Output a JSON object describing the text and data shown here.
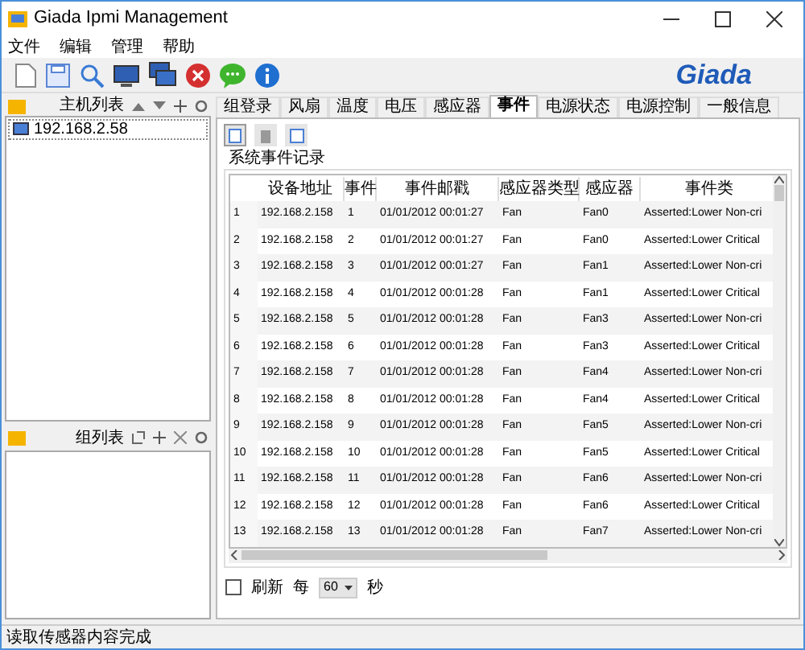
{
  "window": {
    "title": "Giada Ipmi Management"
  },
  "menu": [
    "文件",
    "编辑",
    "管理",
    "帮助"
  ],
  "logo": "Giada",
  "host_panel": {
    "title": "主机列表",
    "items": [
      {
        "label": "192.168.2.58",
        "selected": true
      }
    ]
  },
  "group_panel": {
    "title": "组列表"
  },
  "tabs": [
    {
      "label": "组登录",
      "selected": false
    },
    {
      "label": "风扇",
      "selected": false
    },
    {
      "label": "温度",
      "selected": false
    },
    {
      "label": "电压",
      "selected": false
    },
    {
      "label": "感应器",
      "selected": false
    },
    {
      "label": "事件",
      "selected": true
    },
    {
      "label": "电源状态",
      "selected": false
    },
    {
      "label": "电源控制",
      "selected": false
    },
    {
      "label": "一般信息",
      "selected": false
    }
  ],
  "group_box": {
    "title": "系统事件记录"
  },
  "table": {
    "columns": [
      "",
      "设备地址",
      "事件",
      "事件邮戳",
      "感应器类型",
      "感应器",
      "事件类"
    ],
    "rows": [
      [
        "1",
        "192.168.2.158",
        "1",
        "01/01/2012 00:01:27",
        "Fan",
        "Fan0",
        "Asserted:Lower Non-cri"
      ],
      [
        "2",
        "192.168.2.158",
        "2",
        "01/01/2012 00:01:27",
        "Fan",
        "Fan0",
        "Asserted:Lower Critical"
      ],
      [
        "3",
        "192.168.2.158",
        "3",
        "01/01/2012 00:01:27",
        "Fan",
        "Fan1",
        "Asserted:Lower Non-cri"
      ],
      [
        "4",
        "192.168.2.158",
        "4",
        "01/01/2012 00:01:28",
        "Fan",
        "Fan1",
        "Asserted:Lower Critical"
      ],
      [
        "5",
        "192.168.2.158",
        "5",
        "01/01/2012 00:01:28",
        "Fan",
        "Fan3",
        "Asserted:Lower Non-cri"
      ],
      [
        "6",
        "192.168.2.158",
        "6",
        "01/01/2012 00:01:28",
        "Fan",
        "Fan3",
        "Asserted:Lower Critical"
      ],
      [
        "7",
        "192.168.2.158",
        "7",
        "01/01/2012 00:01:28",
        "Fan",
        "Fan4",
        "Asserted:Lower Non-cri"
      ],
      [
        "8",
        "192.168.2.158",
        "8",
        "01/01/2012 00:01:28",
        "Fan",
        "Fan4",
        "Asserted:Lower Critical"
      ],
      [
        "9",
        "192.168.2.158",
        "9",
        "01/01/2012 00:01:28",
        "Fan",
        "Fan5",
        "Asserted:Lower Non-cri"
      ],
      [
        "10",
        "192.168.2.158",
        "10",
        "01/01/2012 00:01:28",
        "Fan",
        "Fan5",
        "Asserted:Lower Critical"
      ],
      [
        "11",
        "192.168.2.158",
        "11",
        "01/01/2012 00:01:28",
        "Fan",
        "Fan6",
        "Asserted:Lower Non-cri"
      ],
      [
        "12",
        "192.168.2.158",
        "12",
        "01/01/2012 00:01:28",
        "Fan",
        "Fan6",
        "Asserted:Lower Critical"
      ],
      [
        "13",
        "192.168.2.158",
        "13",
        "01/01/2012 00:01:28",
        "Fan",
        "Fan7",
        "Asserted:Lower Non-cri"
      ]
    ]
  },
  "refresh": {
    "label": "刷新",
    "checked": false,
    "every": "每",
    "interval": "60",
    "unit": "秒"
  },
  "status_bar": "读取传感器内容完成"
}
